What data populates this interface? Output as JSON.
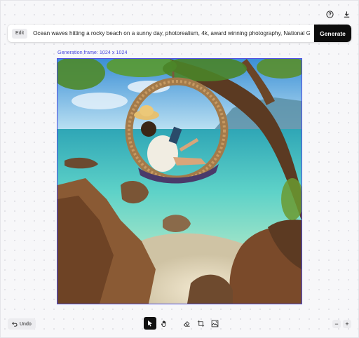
{
  "header": {
    "icons": [
      "help-icon",
      "download-icon"
    ]
  },
  "prompt": {
    "mode_label": "Edit",
    "value": "Ocean waves hitting a rocky beach on a sunny day, photorealism, 4k, award winning photography, National Geographic",
    "generate_label": "Generate"
  },
  "canvas": {
    "frame_label": "Generation frame: 1024 x 1024",
    "image_subject": "woman reading in a rattan swing hanging from a tree above a rocky tropical beach"
  },
  "footer": {
    "undo_label": "Undo",
    "tools": [
      "select-tool",
      "pan-tool",
      "eraser-tool",
      "crop-tool",
      "image-edit-tool"
    ],
    "active_tool": "select-tool",
    "zoom_out_label": "−",
    "zoom_in_label": "+"
  },
  "colors": {
    "accent": "#4747e0",
    "primary_button": "#0c0c0c"
  }
}
